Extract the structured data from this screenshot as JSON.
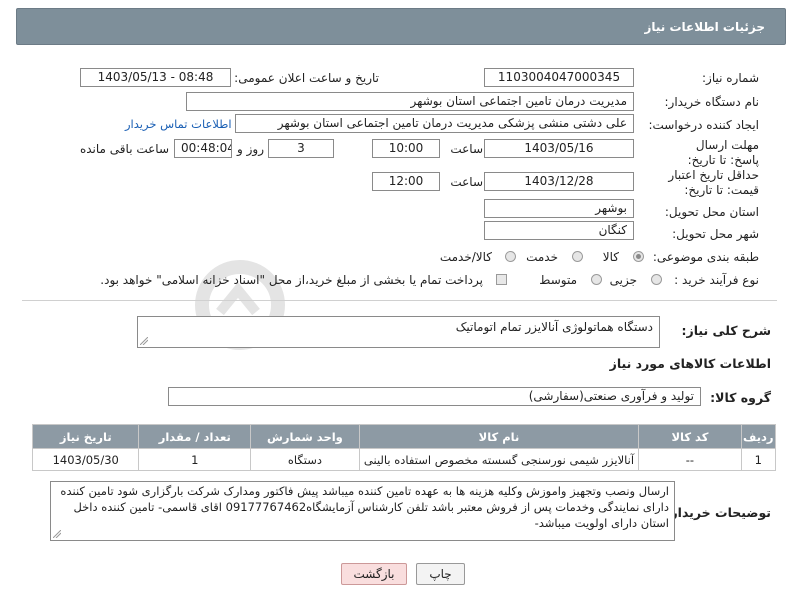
{
  "header": {
    "title": "جزئیات اطلاعات نیاز"
  },
  "watermark": {
    "text": "AriaTender.neT"
  },
  "form": {
    "need_number_label": "شماره نیاز:",
    "need_number": "1103004047000345",
    "announce_label": "تاریخ و ساعت اعلان عمومی:",
    "announce_value": "1403/05/13 - 08:48",
    "buyer_org_label": "نام دستگاه خریدار:",
    "buyer_org": "مدیریت درمان تامین اجتماعی استان بوشهر",
    "creator_label": "ایجاد کننده درخواست:",
    "creator": "علی دشتی منشی پزشکی مدیریت درمان تامین اجتماعی استان بوشهر",
    "contact_link": "اطلاعات تماس خریدار",
    "reply_deadline_label": "مهلت ارسال پاسخ: تا تاریخ:",
    "reply_date": "1403/05/16",
    "time_label": "ساعت",
    "reply_time": "10:00",
    "days_value": "3",
    "days_label": "روز و",
    "remaining_value": "00:48:04",
    "remaining_label": "ساعت باقی مانده",
    "price_validity_label": "حداقل تاریخ اعتبار قیمت: تا تاریخ:",
    "validity_date": "1403/12/28",
    "validity_time": "12:00",
    "province_label": "استان محل تحویل:",
    "province": "بوشهر",
    "city_label": "شهر محل تحویل:",
    "city": "کنگان",
    "category_label": "طبقه بندی موضوعی:",
    "category_options": [
      "کالا",
      "خدمت",
      "کالا/خدمت"
    ],
    "process_label": "نوع فرآیند خرید :",
    "process_options": [
      "جزیی",
      "متوسط"
    ],
    "payment_note": "پرداخت تمام یا بخشی از مبلغ خرید،از محل \"اسناد خزانه اسلامی\" خواهد بود."
  },
  "summary": {
    "label": "شرح کلی نیاز:",
    "text": "دستگاه هماتولوژی آنالایزر تمام اتوماتیک"
  },
  "goods_info_title": "اطلاعات کالاهای مورد نیاز",
  "goods_group": {
    "label": "گروه کالا:",
    "value": "تولید و فرآوری صنعتی(سفارشی)"
  },
  "table": {
    "headers": [
      "ردیف",
      "کد کالا",
      "نام کالا",
      "واحد شمارش",
      "تعداد / مقدار",
      "تاریخ نیاز"
    ],
    "rows": [
      [
        "1",
        "--",
        "آنالایزر شیمی نورسنجی گسسته مخصوص استفاده بالینی",
        "دستگاه",
        "1",
        "1403/05/30"
      ]
    ]
  },
  "buyer_notes": {
    "label": "توضیحات خریدار:",
    "text": "ارسال ونصب وتجهیز واموزش وکلیه هزینه ها به عهده تامین کننده میباشد پیش فاکتور ومدارک شرکت بارگزاری شود تامین کننده دارای نمایندگی وخدمات پس از فروش معتبر باشد تلفن کارشناس آزمایشگاه09177767462 اقای قاسمی- تامین کننده داخل استان دارای اولویت میباشد-"
  },
  "buttons": {
    "print": "چاپ",
    "back": "بازگشت"
  },
  "colors": {
    "header_bg": "#7e8f9a",
    "table_header_bg": "#8d9aa4",
    "link": "#1a5fb4",
    "back_bg": "#f9dede"
  }
}
